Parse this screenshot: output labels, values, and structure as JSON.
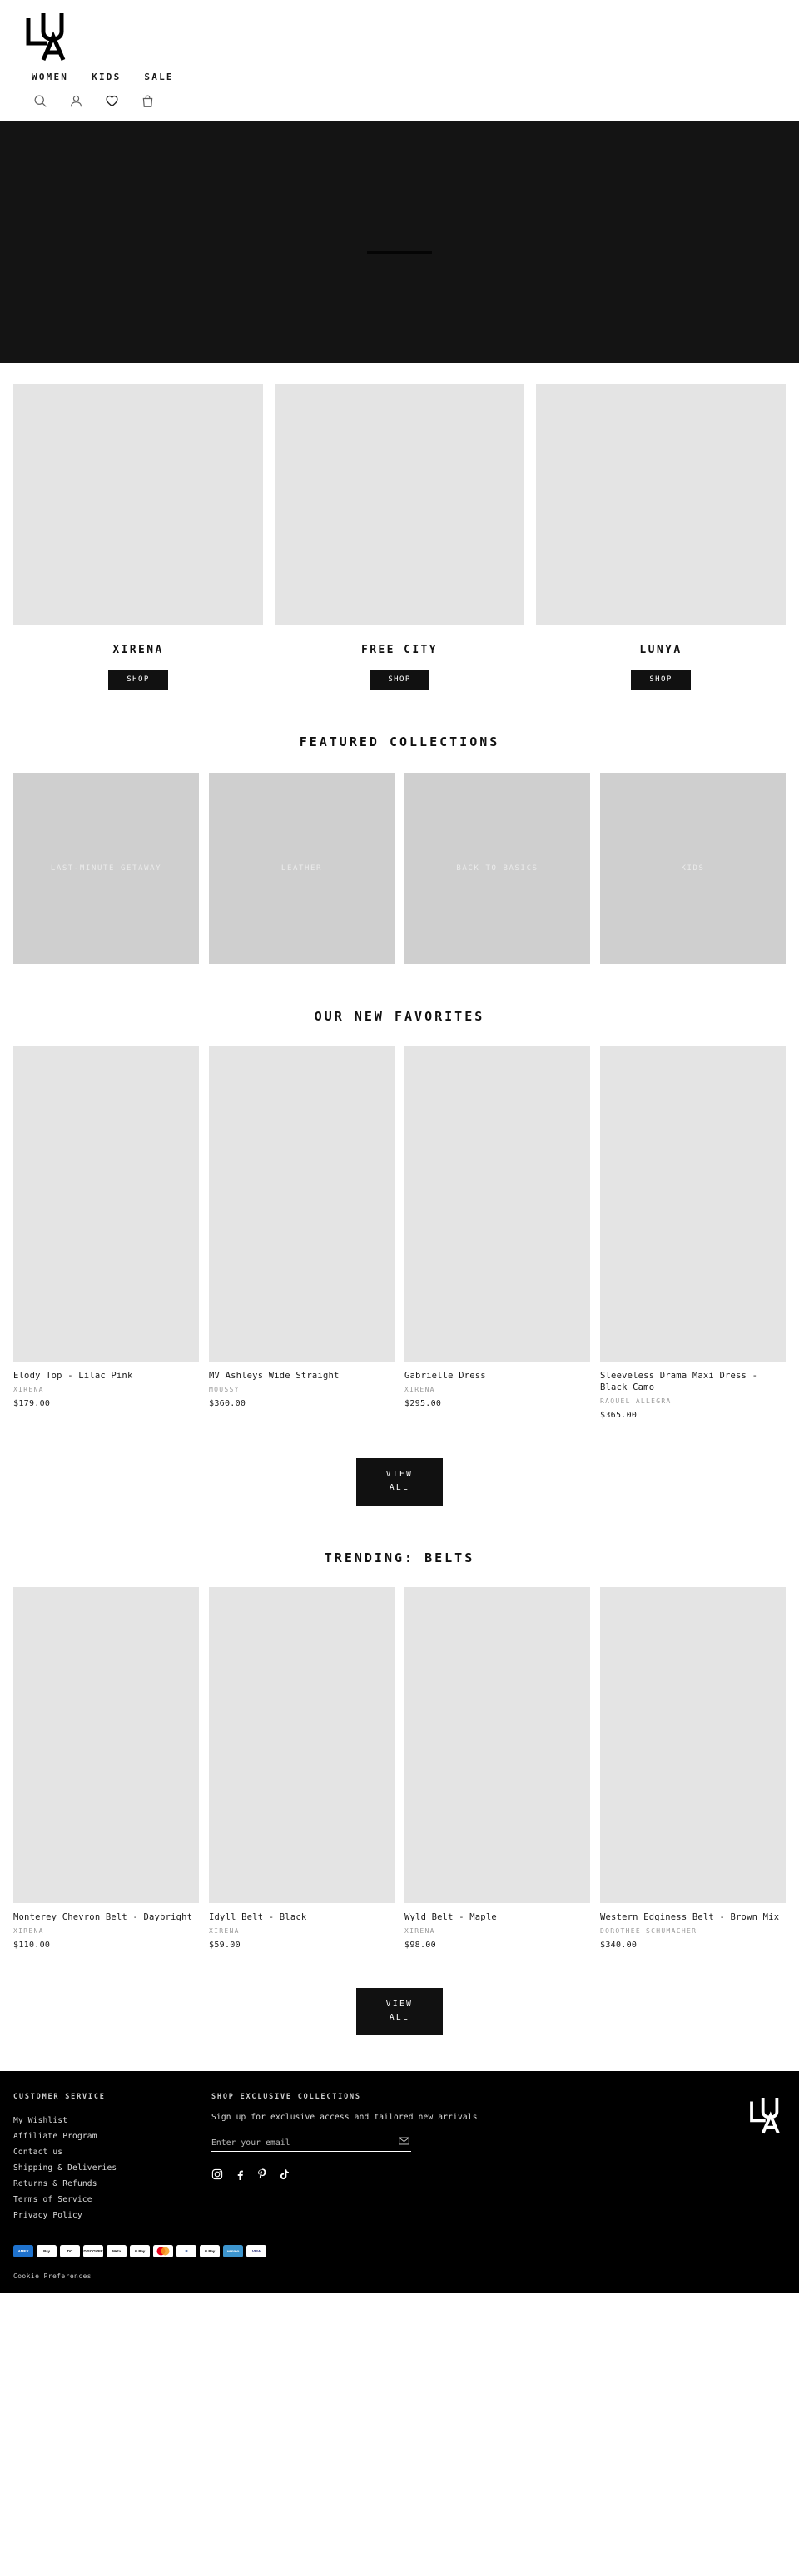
{
  "brand": {
    "name": "LUA",
    "logo_letters": [
      "L",
      "U",
      "A"
    ]
  },
  "header": {
    "nav": [
      {
        "label": "WOMEN",
        "name": "nav-women"
      },
      {
        "label": "KIDS",
        "name": "nav-kids"
      },
      {
        "label": "SALE",
        "name": "nav-sale"
      }
    ],
    "icons": [
      {
        "label": "search-icon"
      },
      {
        "label": "account-icon"
      },
      {
        "label": "wishlist-heart-icon"
      },
      {
        "label": "cart-bag-icon"
      }
    ]
  },
  "hero": {
    "alt": "hero-banner"
  },
  "brand_cards": [
    {
      "name": "XIRENA",
      "shop_label": "SHOP"
    },
    {
      "name": "FREE CITY",
      "shop_label": "SHOP"
    },
    {
      "name": "LUNYA",
      "shop_label": "SHOP"
    }
  ],
  "featured_collections": {
    "title": "FEATURED COLLECTIONS",
    "tiles": [
      {
        "label": "LAST-MINUTE GETAWAY"
      },
      {
        "label": "LEATHER"
      },
      {
        "label": "BACK TO BASICS"
      },
      {
        "label": "KIDS"
      }
    ]
  },
  "new_favorites": {
    "title": "OUR NEW FAVORITES",
    "view_all_line1": "VIEW",
    "view_all_line2": "ALL",
    "products": [
      {
        "title": "Elody Top - Lilac Pink",
        "brand": "XIRENA",
        "price": "$179.00"
      },
      {
        "title": "MV Ashleys Wide Straight",
        "brand": "MOUSSY",
        "price": "$360.00"
      },
      {
        "title": "Gabrielle Dress",
        "brand": "XIRENA",
        "price": "$295.00"
      },
      {
        "title": "Sleeveless Drama Maxi Dress - Black Camo",
        "brand": "RAQUEL ALLEGRA",
        "price": "$365.00"
      }
    ]
  },
  "trending_belts": {
    "title": "TRENDING: BELTS",
    "view_all_line1": "VIEW",
    "view_all_line2": "ALL",
    "products": [
      {
        "title": "Monterey Chevron Belt - Daybright",
        "brand": "XIRENA",
        "price": "$110.00"
      },
      {
        "title": "Idyll Belt - Black",
        "brand": "XIRENA",
        "price": "$59.00"
      },
      {
        "title": "Wyld Belt - Maple",
        "brand": "XIRENA",
        "price": "$98.00"
      },
      {
        "title": "Western Edginess Belt - Brown Mix",
        "brand": "DOROTHEE SCHUMACHER",
        "price": "$340.00"
      }
    ]
  },
  "footer": {
    "customer_service": {
      "heading": "CUSTOMER SERVICE",
      "links": [
        "My Wishlist",
        "Affiliate Program",
        "Contact us",
        "Shipping & Deliveries",
        "Returns & Refunds",
        "Terms of Service",
        "Privacy Policy"
      ]
    },
    "newsletter": {
      "heading": "SHOP EXCLUSIVE COLLECTIONS",
      "subtext": "Sign up for exclusive access and tailored new arrivals",
      "placeholder": "Enter your email",
      "value": "",
      "submit_icon": "envelope-icon"
    },
    "socials": [
      {
        "name": "instagram-icon"
      },
      {
        "name": "facebook-icon"
      },
      {
        "name": "pinterest-icon"
      },
      {
        "name": "tiktok-icon"
      }
    ],
    "payments": [
      {
        "label": "AMEX",
        "cls": "amex"
      },
      {
        "label": "Pay",
        "cls": "apay"
      },
      {
        "label": "DC",
        "cls": "dc"
      },
      {
        "label": "DISCOVER",
        "cls": "disc"
      },
      {
        "label": "Meta",
        "cls": "meta"
      },
      {
        "label": "G Pay",
        "cls": "gpay"
      },
      {
        "label": "MC",
        "cls": "mc"
      },
      {
        "label": "P",
        "cls": "pp"
      },
      {
        "label": "G Pay",
        "cls": "gpay"
      },
      {
        "label": "venmo",
        "cls": "venmo"
      },
      {
        "label": "VISA",
        "cls": "visa"
      }
    ],
    "cookie_label": "Cookie Preferences"
  },
  "colors": {
    "background": "#ffffff",
    "ink": "#111111",
    "hero": "#141414",
    "placeholder_img": "#e4e4e4",
    "tile": "#cfcfcf",
    "footer_bg": "#000000",
    "muted_text": "#9a9a9a"
  }
}
